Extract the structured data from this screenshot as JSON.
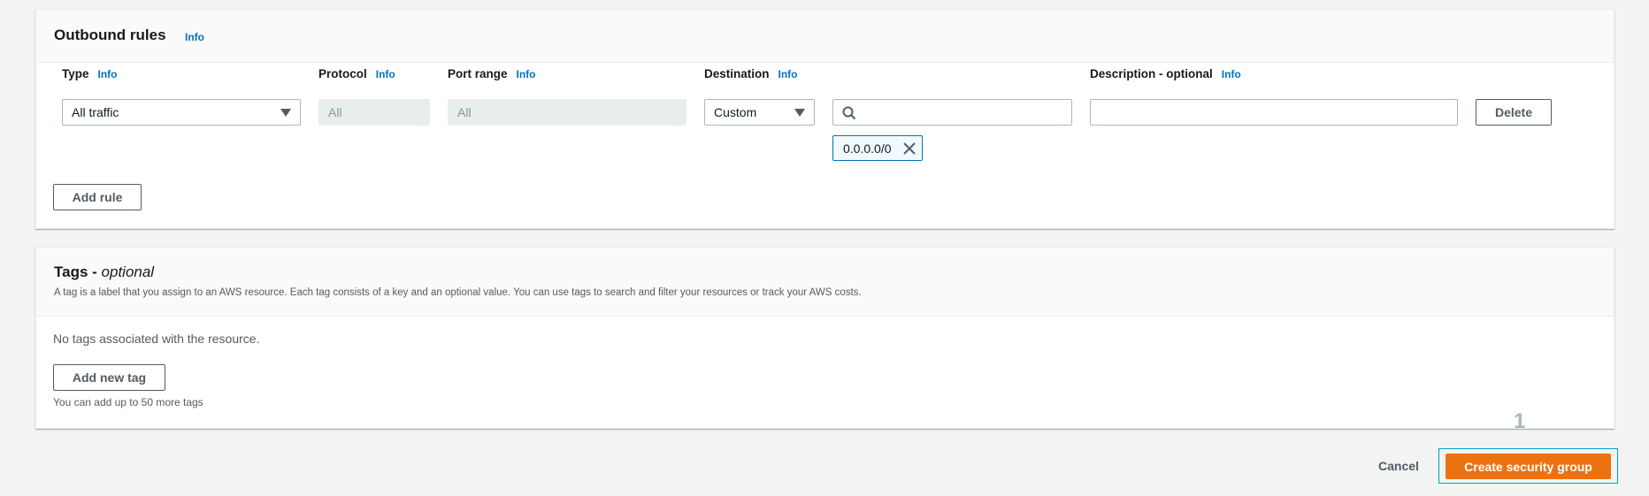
{
  "outbound": {
    "title": "Outbound rules",
    "info": "Info",
    "columns": {
      "type": "Type",
      "protocol": "Protocol",
      "port_range": "Port range",
      "destination": "Destination",
      "description": "Description - optional"
    },
    "rule": {
      "type_value": "All traffic",
      "protocol_value": "All",
      "port_range_value": "All",
      "destination_mode": "Custom",
      "destination_search_value": "",
      "cidr_token": "0.0.0.0/0",
      "description_value": ""
    },
    "delete_label": "Delete",
    "add_rule_label": "Add rule"
  },
  "tags": {
    "title_prefix": "Tags - ",
    "title_italic": "optional",
    "description": "A tag is a label that you assign to an AWS resource. Each tag consists of a key and an optional value. You can use tags to search and filter your resources or track your AWS costs.",
    "empty_text": "No tags associated with the resource.",
    "add_tag_label": "Add new tag",
    "limit_text": "You can add up to 50 more tags"
  },
  "footer": {
    "cancel_label": "Cancel",
    "create_label": "Create security group",
    "step_badge": "1"
  },
  "colors": {
    "accent": "#ec7211",
    "link": "#0073bb",
    "focus": "#00a1c9"
  }
}
